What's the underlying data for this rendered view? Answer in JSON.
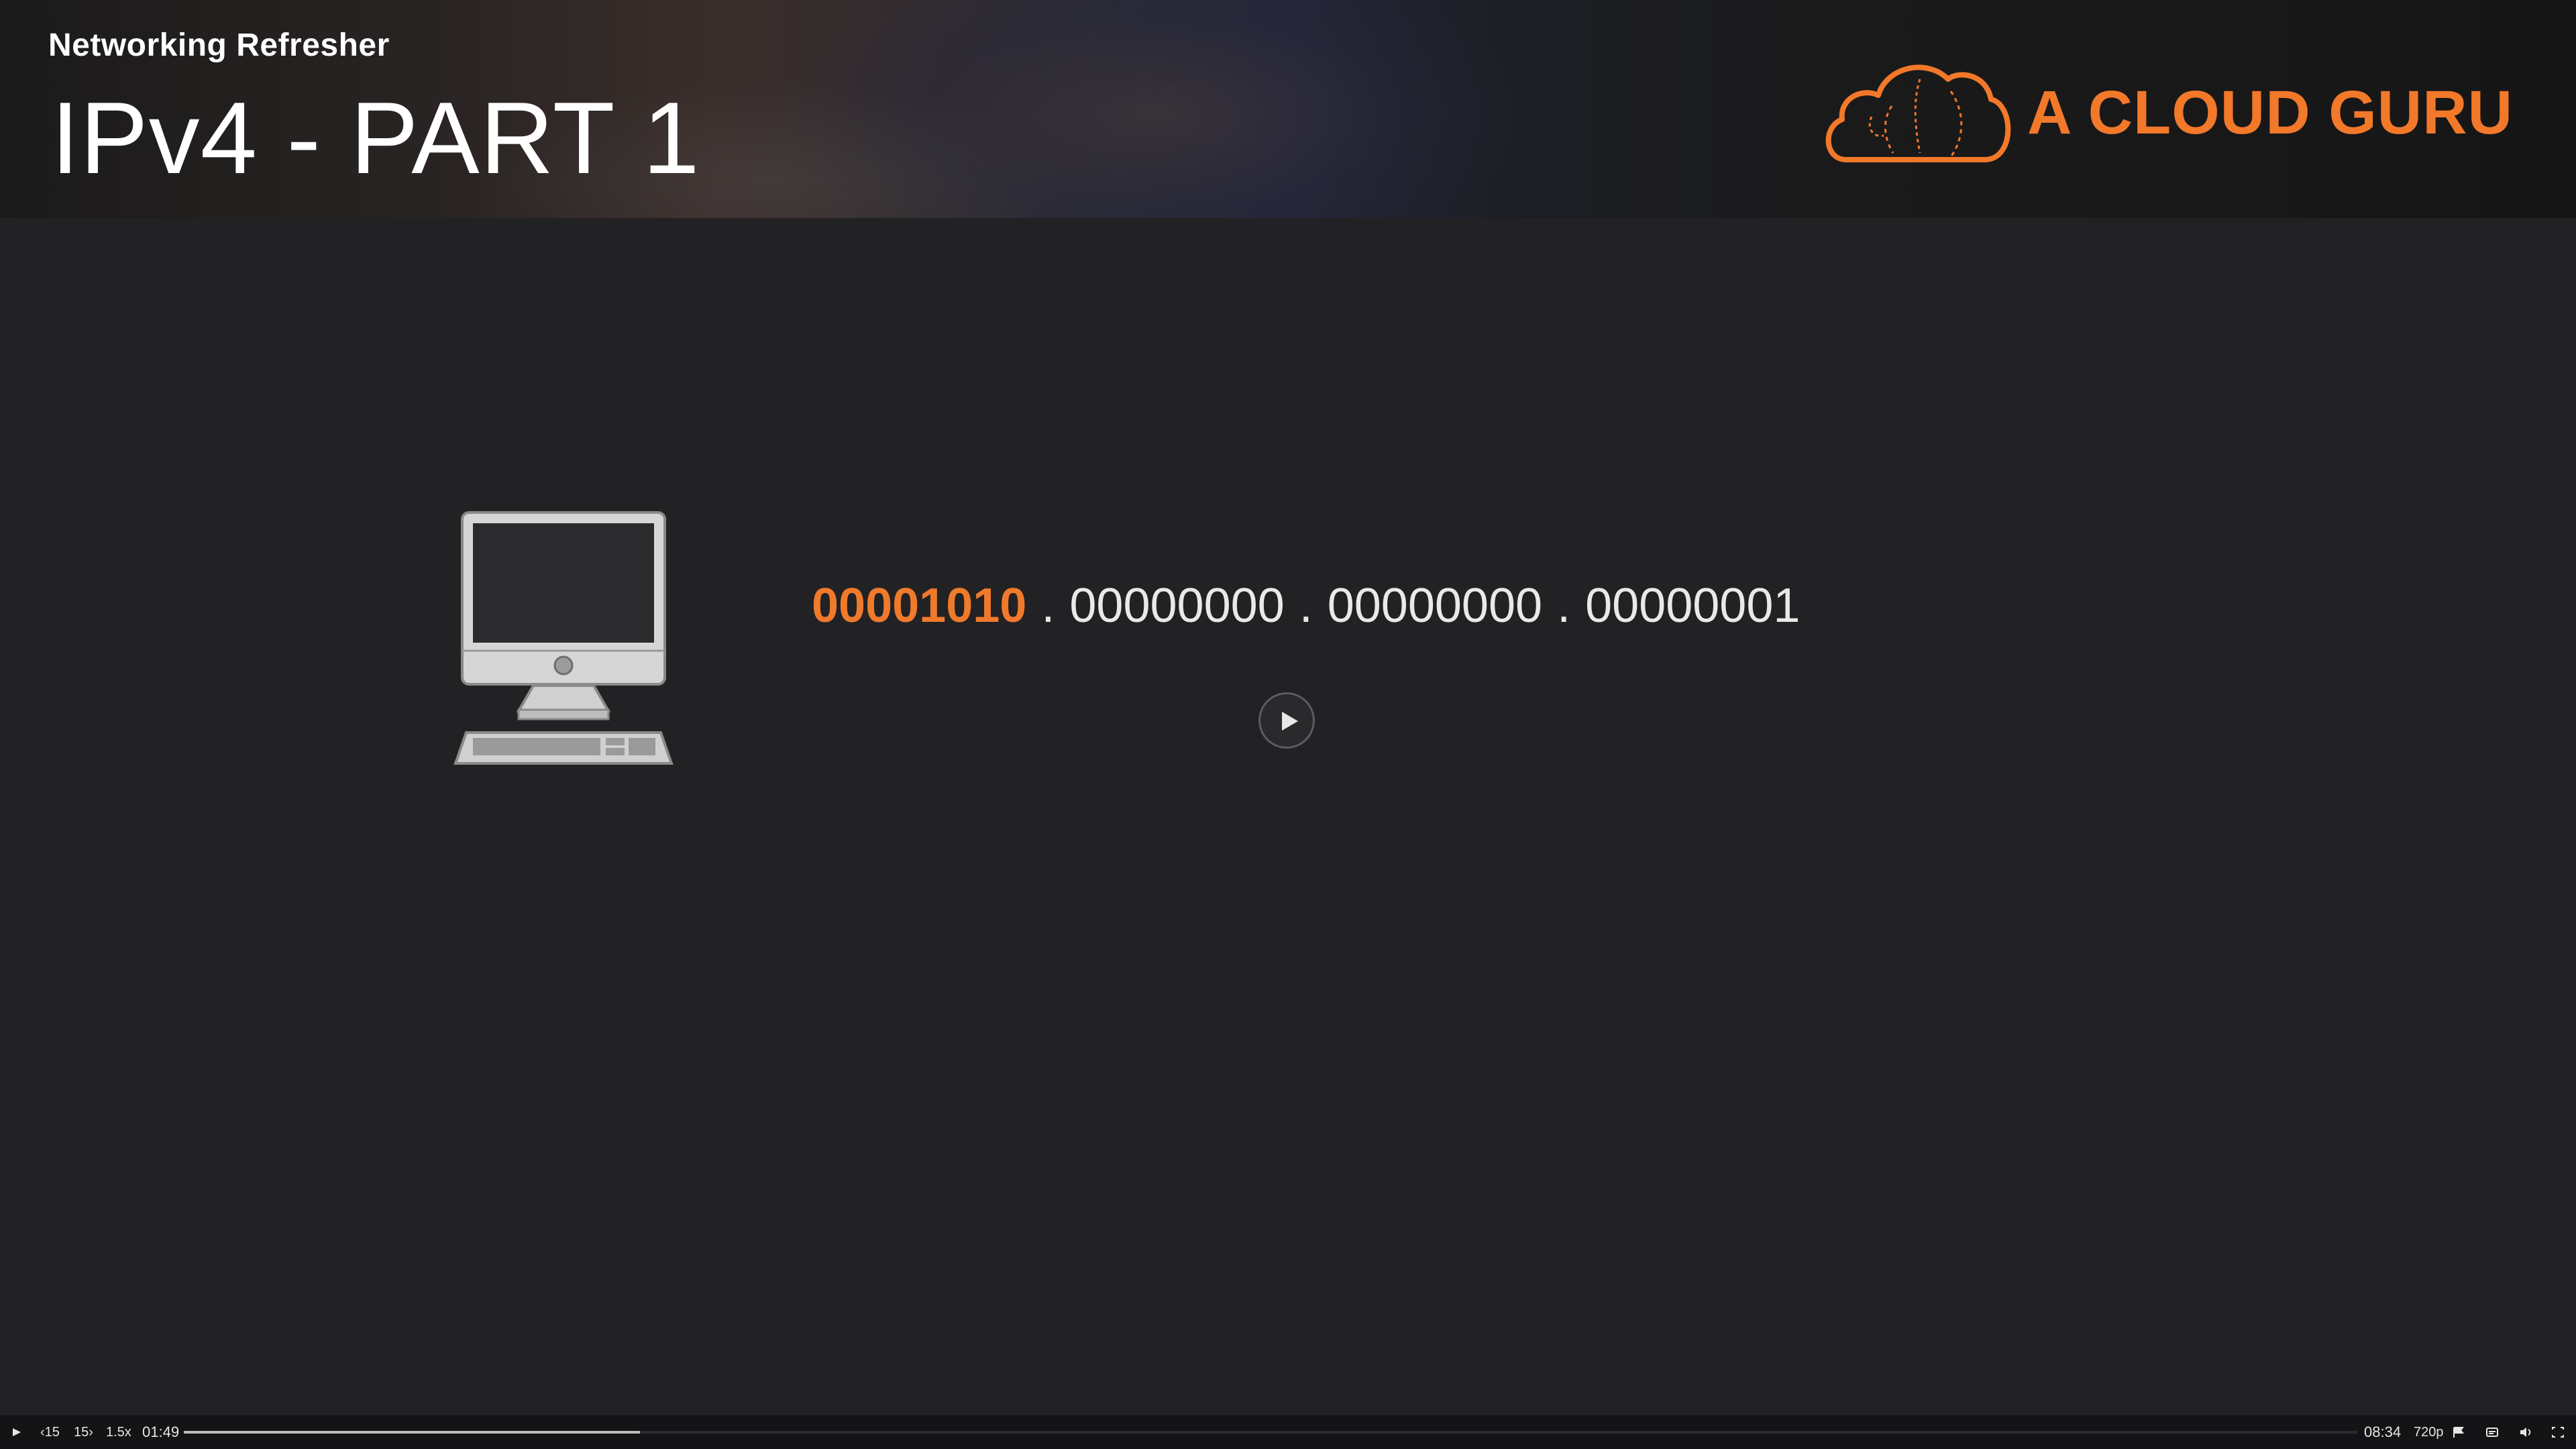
{
  "banner": {
    "course_label": "Networking Refresher",
    "lesson_title": "IPv4 - PART 1",
    "brand_name": "A CLOUD GURU",
    "brand_color": "#f2782a"
  },
  "slide": {
    "computer_icon": "desktop-computer-icon",
    "ip_address": {
      "octets": [
        "00001010",
        "00000000",
        "00000000",
        "00000001"
      ],
      "highlighted_octet_index": 0,
      "separator": ".",
      "highlight_color": "#f07a2c"
    },
    "center_play_icon": "play-icon"
  },
  "player": {
    "play_icon": "play-icon",
    "rewind_label": "15",
    "forward_label": "15",
    "speed": "1.5x",
    "current_time": "01:49",
    "total_time": "08:34",
    "quality": "720p",
    "progress_fraction": 0.21,
    "icons": {
      "bookmark": "flag-icon",
      "captions": "captions-icon",
      "volume": "volume-icon",
      "fullscreen": "fullscreen-icon"
    }
  }
}
